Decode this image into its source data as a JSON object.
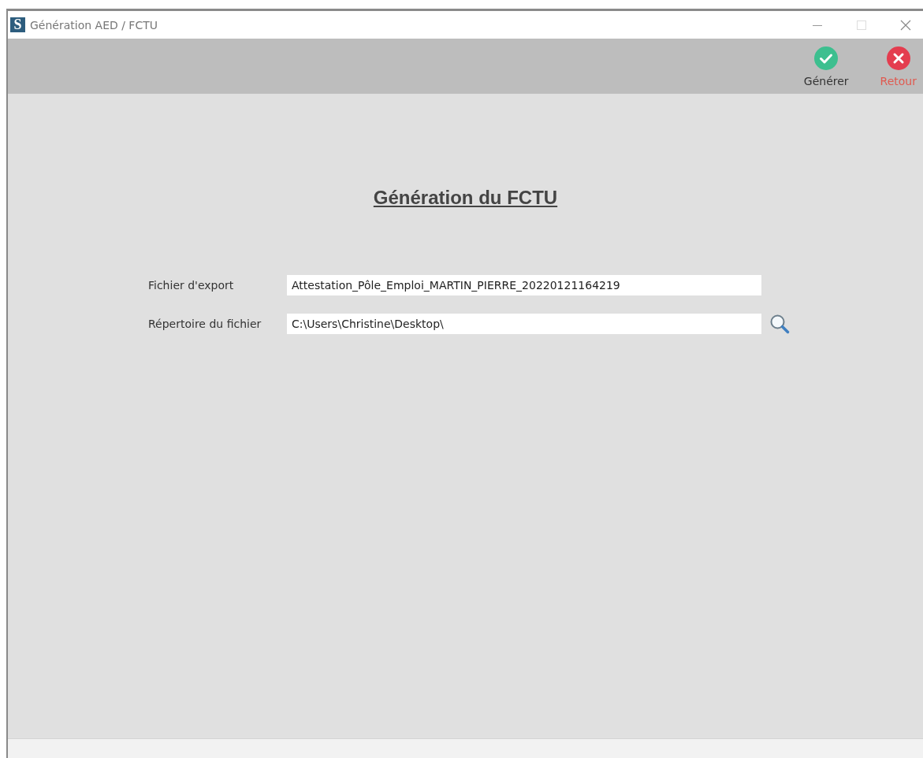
{
  "window": {
    "title": "Génération AED / FCTU",
    "app_icon": "S"
  },
  "toolbar": [
    {
      "kind": "confirm",
      "label": "Générer"
    },
    {
      "kind": "cancel",
      "label": "Retour"
    }
  ],
  "heading": "Génération du FCTU",
  "fields": [
    {
      "kind": "text",
      "label": "Fichier d'export",
      "value": "Attestation_Pôle_Emploi_MARTIN_PIERRE_20220121164219"
    },
    {
      "kind": "browse",
      "label": "Répertoire du fichier",
      "value": "C:\\Users\\Christine\\Desktop\\"
    }
  ]
}
